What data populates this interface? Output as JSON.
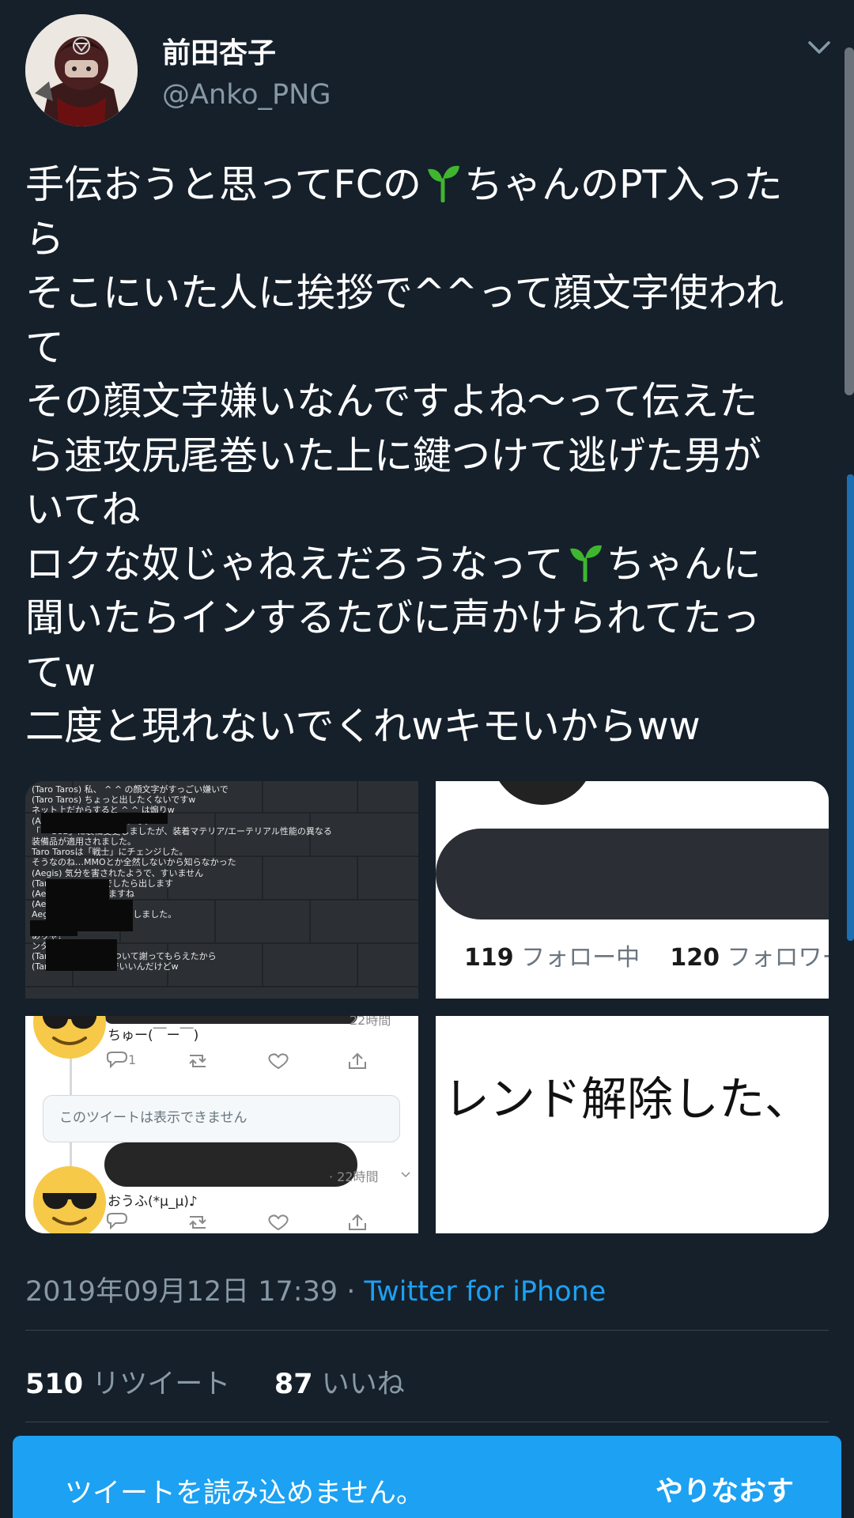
{
  "user": {
    "display_name": "前田杏子",
    "handle": "@Anko_PNG"
  },
  "tweet": {
    "lines": [
      [
        "手伝おうと思ってFCの",
        "sprout",
        "ちゃんのPT入った"
      ],
      [
        "ら"
      ],
      [
        "そこにいた人に挨拶で^^って顔文字使われ"
      ],
      [
        "て"
      ],
      [
        "その顔文字嫌いなんですよね〜って伝えた"
      ],
      [
        "ら速攻尻尾巻いた上に鍵つけて逃げた男が"
      ],
      [
        "いてね"
      ],
      [
        "ロクな奴じゃねえだろうなって",
        "sprout",
        "ちゃんに"
      ],
      [
        "聞いたらインするたびに声かけられてたっ"
      ],
      [
        "てw"
      ],
      [
        "二度と現れないでくれwキモいからww"
      ]
    ]
  },
  "media": {
    "m1_chat": [
      "(Taro Taros) 私、 ^ ^ の顔文字がすっごい嫌いで",
      "(Taro Taros) ちょっと出したくないですw",
      "ネット上だからすると    ^ ^ は煽りw",
      "(Aegis) それは申し訳ないです",
      "「 ～382」に装備変更しましたが、装着マテリア/エーテリアル性能の異なる",
      "装備品が適用されました。",
      "Taro Tarosは「戦士」にチェンジした。",
      "そうなのね…MMOとか全然しないから知らなかった",
      "(Aegis) 気分を害されたようで、すいません",
      "(Taro Taros) お k   でしたら出します",
      "(Aegis) 私抜けときますね",
      "(Aegis) すいませんでした",
      "Aegisがパーティから離脱しました。",
      "",
      "ありゃ？",
      "ンタル豆腐かよ",
      "(Taro Taros) ^ ^ について謝ってもらえたから",
      "(Taro Taros) 別に庇でいいんだけどw"
    ],
    "m2_following_count": "119",
    "m2_following_label": "フォロー中",
    "m2_followers_count": "120",
    "m2_followers_label": "フォロワー",
    "m3_reply1_text": "ちゅー(￣ー￣)",
    "m3_reply1_time": "22時間",
    "m3_reply_count": "1",
    "m3_unavailable": "このツイートは表示できません",
    "m3_reply2_time": "· 22時間",
    "m3_reply2_text": "おうふ(*µ_µ)♪",
    "m4_text": "レンド解除した、"
  },
  "meta": {
    "timestamp": "2019年09月12日 17:39 · ",
    "source": "Twitter for iPhone",
    "retweet_count": "510",
    "retweet_label": "リツイート",
    "like_count": "87",
    "like_label": "いいね"
  },
  "error": {
    "message": "ツイートを読み込めません。",
    "retry_label": "やりなおす"
  },
  "colors": {
    "background": "#15202b",
    "accent": "#1da1f2",
    "secondary_text": "#8899a6",
    "sprout": "#3fb62f"
  }
}
